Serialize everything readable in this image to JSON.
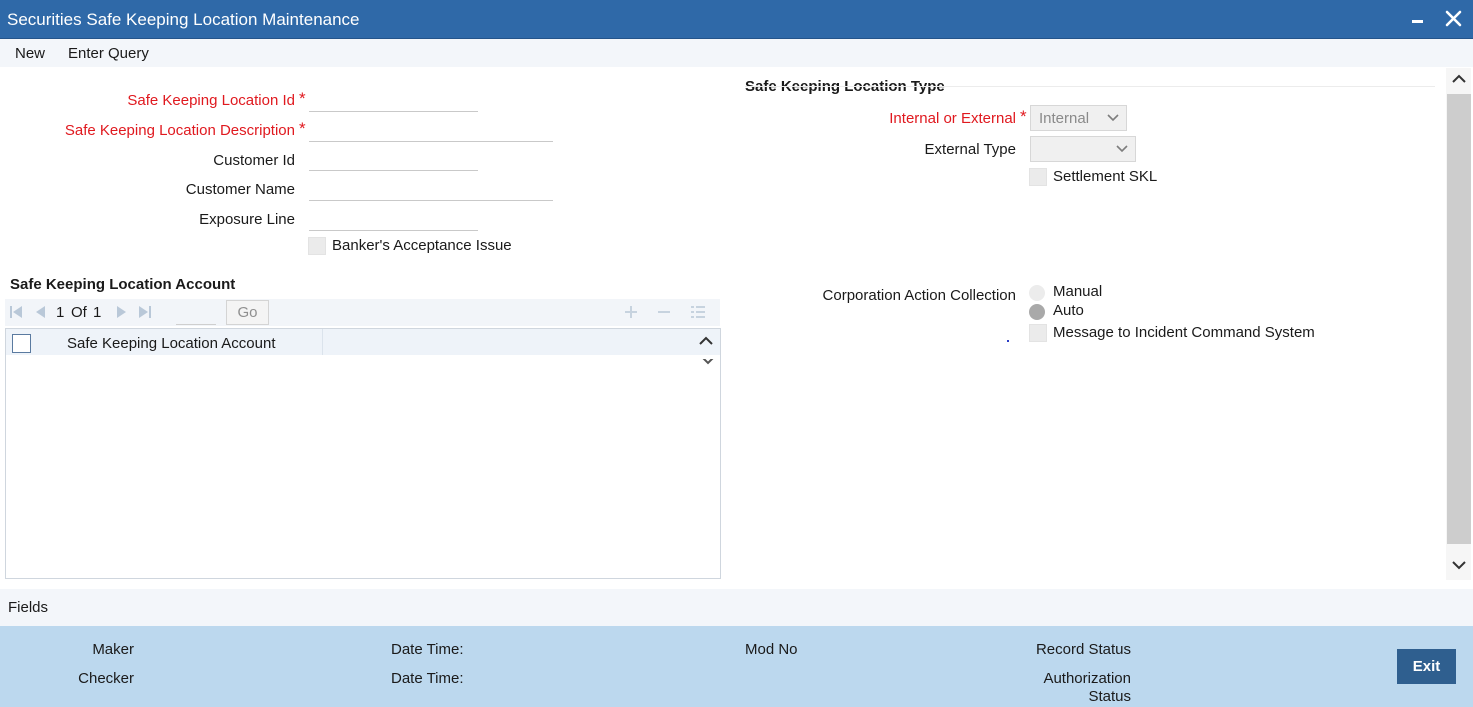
{
  "window": {
    "title": "Securities Safe Keeping Location Maintenance"
  },
  "toolbar": {
    "new_label": "New",
    "enter_query_label": "Enter Query"
  },
  "main_form": {
    "skl_id_label": "Safe Keeping Location Id",
    "skl_id_value": "",
    "skl_desc_label": "Safe Keeping Location Description",
    "skl_desc_value": "",
    "customer_id_label": "Customer Id",
    "customer_id_value": "",
    "customer_name_label": "Customer Name",
    "customer_name_value": "",
    "exposure_line_label": "Exposure Line",
    "exposure_line_value": "",
    "bankers_acceptance_label": "Banker's Acceptance Issue",
    "required_marker": "*"
  },
  "skl_type": {
    "section_title": "Safe Keeping Location Type",
    "internal_external_label": "Internal or External",
    "internal_external_value": "Internal",
    "external_type_label": "External Type",
    "external_type_value": "",
    "settlement_skl_label": "Settlement SKL",
    "corp_action_label": "Corporation Action Collection",
    "radio_manual_label": "Manual",
    "radio_auto_label": "Auto",
    "corp_action_selected": "Auto",
    "message_ics_label": "Message to Incident Command System"
  },
  "account_grid": {
    "section_title": "Safe Keeping Location Account",
    "page_current": "1",
    "page_of": "Of",
    "page_total": "1",
    "go_label": "Go",
    "column_header": "Safe Keeping Location Account",
    "rows": []
  },
  "fields_bar": {
    "label": "Fields"
  },
  "footer": {
    "maker_label": "Maker",
    "checker_label": "Checker",
    "date_time_label_1": "Date Time:",
    "date_time_label_2": "Date Time:",
    "mod_no_label": "Mod No",
    "record_status_label": "Record Status",
    "authorization_label": "Authorization",
    "status_label": "Status",
    "exit_label": "Exit"
  },
  "colors": {
    "titlebar": "#2f69a8",
    "required_label": "#e0191f",
    "footer_bg": "#bcd8ee",
    "exit_button": "#2f5f8f"
  }
}
